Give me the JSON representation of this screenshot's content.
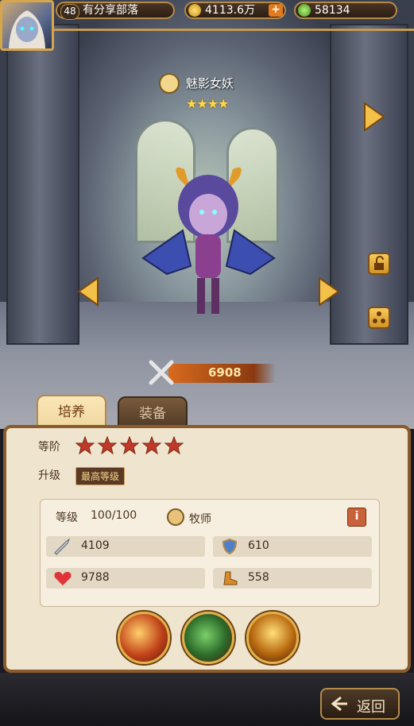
{
  "player": {
    "level": "48",
    "name": "有分享部落",
    "gold": "4113.6万",
    "gold_add": "+",
    "gems": "58134"
  },
  "hero": {
    "name": "魅影女妖",
    "stars": "★★★★",
    "power": "6908"
  },
  "tabs": {
    "cultivate": "培养",
    "equipment": "装备"
  },
  "panel": {
    "rank_label": "等阶",
    "upgrade_label": "升级",
    "max_level_badge": "最高等级",
    "level_label": "等级",
    "level_value": "100/100",
    "class_name": "牧师",
    "info_icon": "i",
    "attack": "4109",
    "defense": "610",
    "hp": "9788",
    "speed": "558"
  },
  "footer": {
    "back_label": "返回"
  },
  "icons": {
    "gold": "coin-icon",
    "gem": "gem-icon",
    "class": "priest-icon",
    "attack": "sword-icon",
    "defense": "shield-icon",
    "hp": "heart-icon",
    "speed": "boot-icon",
    "lock": "unlock-icon",
    "share": "share-icon",
    "power": "crossed-swords-icon"
  },
  "colors": {
    "accent_gold": "#d6a64c",
    "power_bar": "#d86a1f",
    "panel_bg": "#efe4cd"
  }
}
